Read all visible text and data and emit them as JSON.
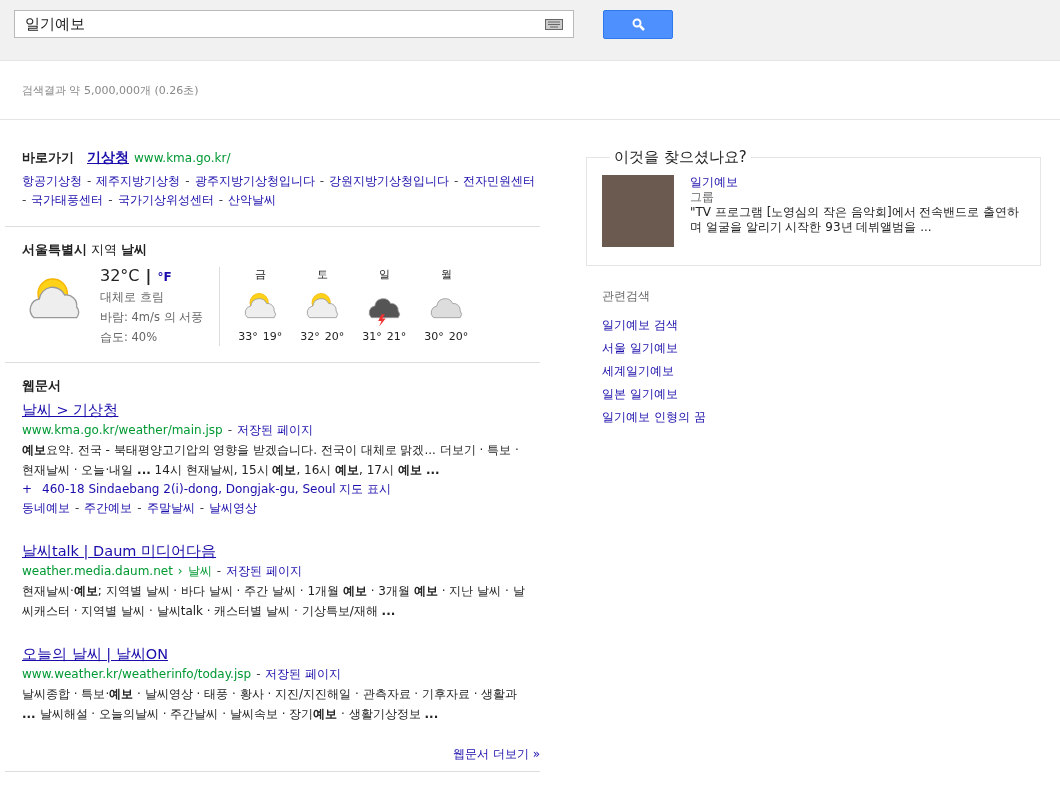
{
  "search": {
    "query": "일기예보"
  },
  "stats": "검색결과 약 5,000,000개 (0.26초)",
  "quick_link": {
    "label": "바로가기",
    "title": "기상청",
    "url": "www.kma.go.kr/",
    "separator": "-",
    "sitelinks": [
      "항공기상청",
      "제주지방기상청",
      "광주지방기상청입니다",
      "강원지방기상청입니다",
      "전자민원센터",
      "국가태풍센터",
      "국가기상위성센터",
      "산악날씨"
    ]
  },
  "weather": {
    "city": "서울특별시",
    "region_label": "지역",
    "title": "날씨",
    "current": {
      "kind": "sun-cloud"
    },
    "temp": "32°C",
    "unit_sep": "|",
    "alt_unit": "°F",
    "condition": "대체로 흐림",
    "wind": "바람: 4m/s 의 서풍",
    "humidity": "습도: 40%",
    "days": [
      {
        "day": "금",
        "kind": "sun-cloud",
        "high": "33°",
        "low": "19°"
      },
      {
        "day": "토",
        "kind": "sun-cloud",
        "high": "32°",
        "low": "20°"
      },
      {
        "day": "일",
        "kind": "storm",
        "high": "31°",
        "low": "21°"
      },
      {
        "day": "월",
        "kind": "cloud",
        "high": "30°",
        "low": "20°"
      }
    ]
  },
  "web": {
    "heading": "웹문서",
    "more": "웹문서 더보기 »",
    "results": [
      {
        "title": "날씨 > 기상청",
        "url": "www.kma.go.kr/weather/main.jsp",
        "cache_sep": "-",
        "cache": "저장된 페이지",
        "snippet": "**예보**요약. 전국 - 북태평양고기압의 영향을 받겠습니다. 전국이 대체로 맑겠... 더보기 · 특보 · 현재날씨 · 오늘·내일 **...** 14시 현재날씨, 15시 **예보**, 16시 **예보**, 17시 **예보 ...**",
        "address_mark": "+",
        "address": "460-18 Sindaebang 2(i)-dong, Dongjak-gu, Seoul 지도 표시",
        "links_sep": "-",
        "links": [
          "동네예보",
          "주간예보",
          "주말날씨",
          "날씨영상"
        ]
      },
      {
        "title": "날씨talk | Daum 미디어다음",
        "url": "weather.media.daum.net",
        "breadcrumb_sep": "›",
        "breadcrumb": "날씨",
        "cache_sep": "-",
        "cache": "저장된 페이지",
        "snippet": "현재날씨·**예보**; 지역별 날씨 · 바다 날씨 · 주간 날씨 · 1개월 **예보** · 3개월 **예보** · 지난 날씨 · 날씨캐스터 · 지역별 날씨 · 날씨talk · 캐스터별 날씨 · 기상특보/재해 **...**"
      },
      {
        "title": "오늘의 날씨 | 날씨ON",
        "url": "www.weather.kr/weatherinfo/today.jsp",
        "cache_sep": "-",
        "cache": "저장된 페이지",
        "snippet": "날씨종합 · 특보·**예보** · 날씨영상 · 태풍 · 황사 · 지진/지진해일 · 관측자료 · 기후자료 · 생활과 **...** 날씨해설 · 오늘의날씨 · 주간날씨 · 날씨속보 · 장기**예보** · 생활기상정보 **...**"
      }
    ]
  },
  "suggest": {
    "heading": "이것을 찾으셨나요?",
    "title": "일기예보",
    "type": "그룹",
    "description": "\"TV 프로그램 [노영심의 작은 음악회]에서 전속밴드로 출연하며 얼굴을 알리기 시작한 93년 데뷔앨범을 ..."
  },
  "related": {
    "heading": "관련검색",
    "items": [
      "일기예보 검색",
      "서울 일기예보",
      "세계일기예보",
      "일본 일기예보",
      "일기예보 인형의 꿈"
    ]
  }
}
